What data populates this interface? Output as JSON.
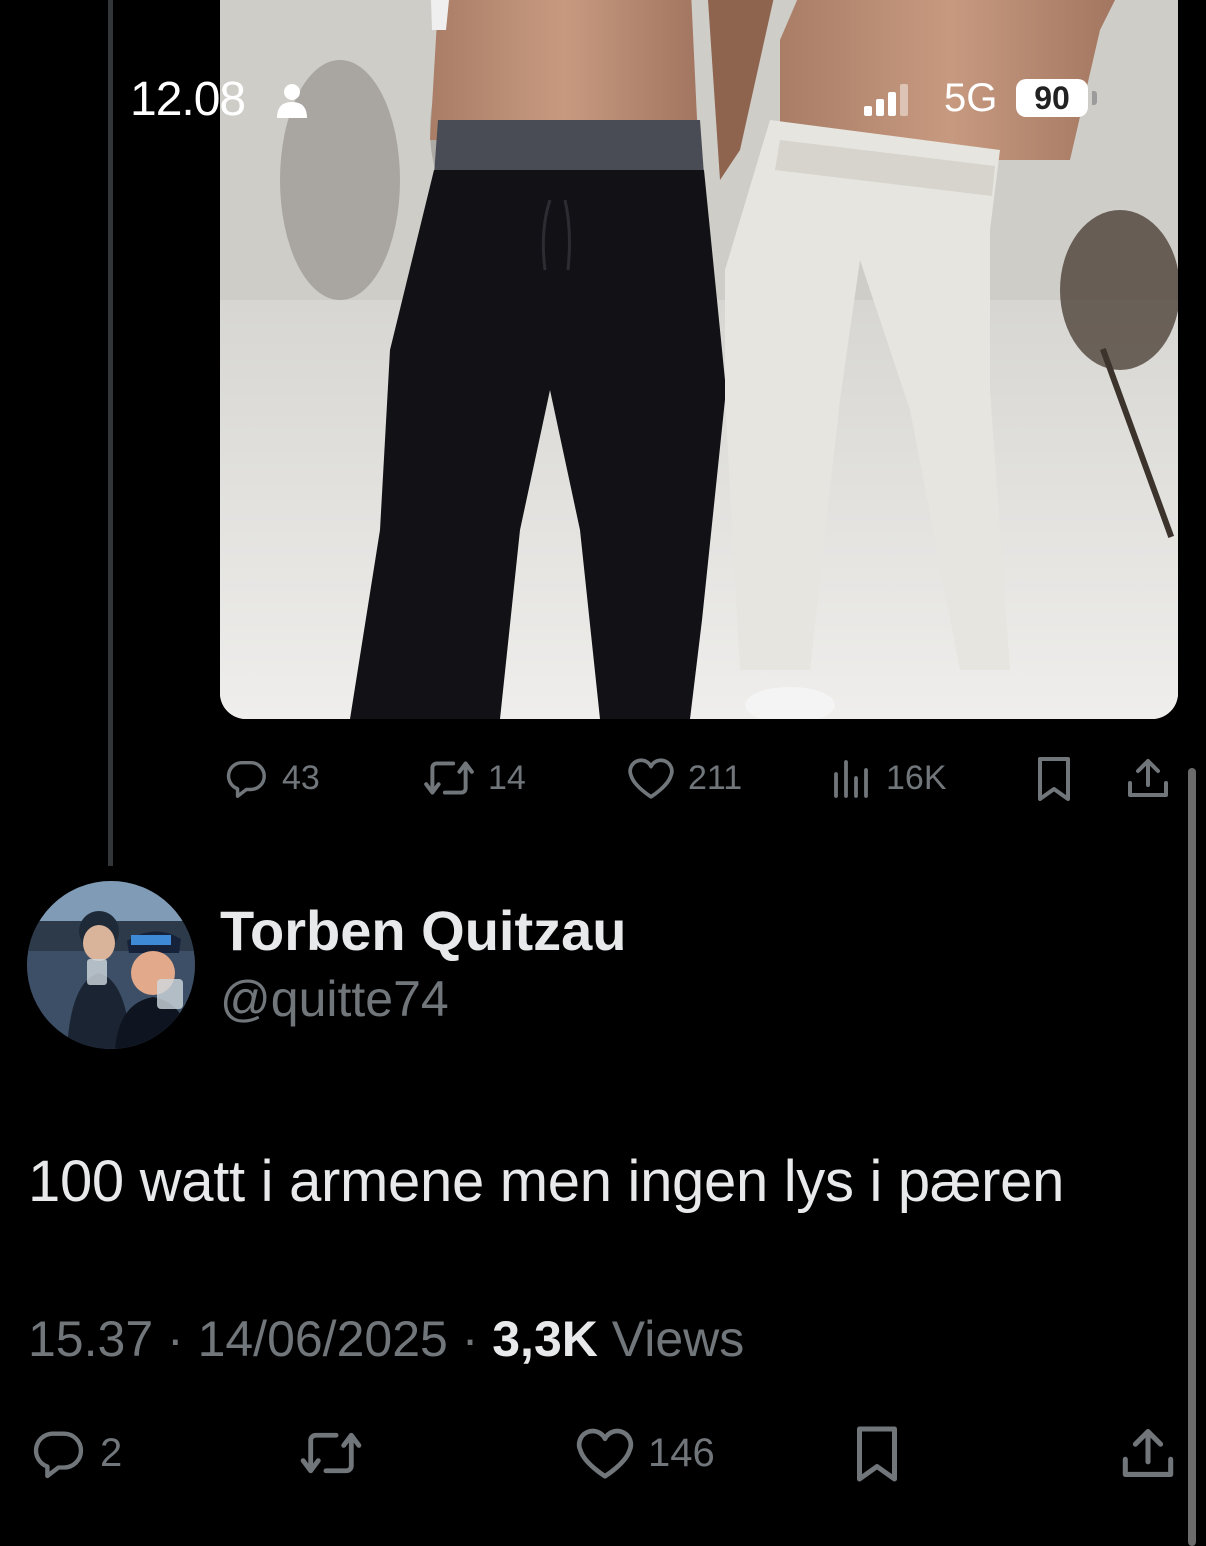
{
  "status_bar": {
    "time": "12.08",
    "network": "5G",
    "battery": "90"
  },
  "quoted_post": {
    "actions": {
      "replies": "43",
      "reposts": "14",
      "likes": "211",
      "views": "16K"
    }
  },
  "post": {
    "author": {
      "display_name": "Torben Quitzau",
      "handle": "@quitte74"
    },
    "text": "100 watt i armene men ingen lys i pæren",
    "time": "15.37",
    "date": "14/06/2025",
    "views_count": "3,3K",
    "views_label": "Views",
    "actions": {
      "replies": "2",
      "reposts": "",
      "likes": "146"
    }
  },
  "colors": {
    "background": "#000000",
    "primary_text": "#e7e9ea",
    "secondary_text": "#71767b",
    "thread_line": "#333639"
  },
  "icons": [
    "person-icon",
    "signal-icon",
    "reply-icon",
    "repost-icon",
    "like-icon",
    "views-icon",
    "bookmark-icon",
    "share-icon"
  ]
}
